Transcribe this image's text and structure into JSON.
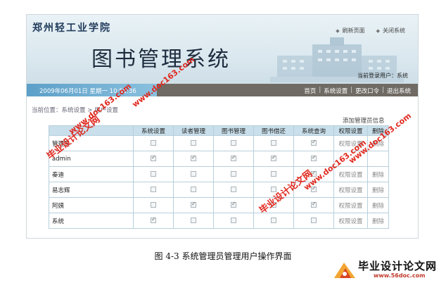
{
  "header": {
    "school_name": "郑州轻工业学院",
    "system_title": "图书管理系统",
    "links": [
      {
        "label": "刷新页面"
      },
      {
        "label": "关闭系统"
      }
    ],
    "current_user": "当前登录用户：系统"
  },
  "navbar": {
    "date": "2009年06月01日 星期一 10:55:36",
    "menu": [
      {
        "label": "首页"
      },
      {
        "label": "系统设置"
      },
      {
        "label": "更改口令"
      },
      {
        "label": "退出系统"
      }
    ]
  },
  "breadcrumb": "当前位置：系统设置 > 用户设置",
  "add_admin_label": "添加管理员信息",
  "table": {
    "columns": [
      "",
      "系统设置",
      "读者管理",
      "图书管理",
      "图书借还",
      "系统查询",
      "权限设置",
      "删除"
    ],
    "rows": [
      {
        "name": "管理员",
        "perms": [
          false,
          false,
          false,
          false,
          true
        ],
        "set": "权限设置",
        "del": "删除"
      },
      {
        "name": "admin",
        "perms": [
          true,
          true,
          true,
          true,
          true
        ],
        "set": "",
        "del": ""
      },
      {
        "name": "秦迪",
        "perms": [
          false,
          false,
          false,
          false,
          true
        ],
        "set": "权限设置",
        "del": "删除"
      },
      {
        "name": "易志辉",
        "perms": [
          false,
          false,
          false,
          false,
          true
        ],
        "set": "权限设置",
        "del": "删除"
      },
      {
        "name": "阿姨",
        "perms": [
          false,
          true,
          true,
          false,
          true
        ],
        "set": "权限设置",
        "del": "删除"
      },
      {
        "name": "系统",
        "perms": [
          true,
          false,
          false,
          false,
          false
        ],
        "set": "权限设置",
        "del": "删除"
      }
    ]
  },
  "watermarks": [
    "毕业设计论文网",
    "www.doc163.com"
  ],
  "caption": "图 4-3 系统管理员管理用户操作界面",
  "logo": {
    "text": "毕业设计论文网",
    "url": "www.56doc.com"
  }
}
